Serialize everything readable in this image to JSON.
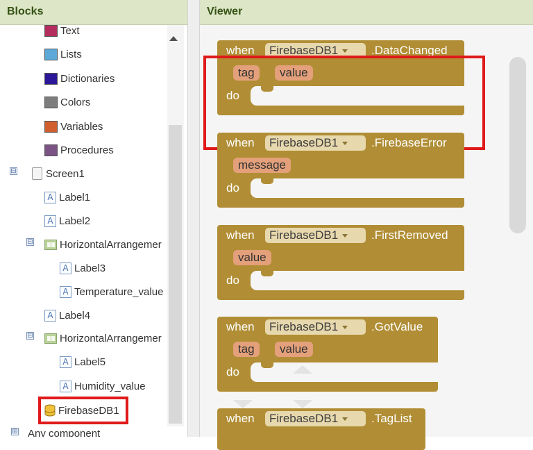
{
  "blocks_panel": {
    "title": "Blocks",
    "items": [
      {
        "label": "Text",
        "color": "#b32d5e"
      },
      {
        "label": "Lists",
        "color": "#5ba8d9"
      },
      {
        "label": "Dictionaries",
        "color": "#2d1799"
      },
      {
        "label": "Colors",
        "color": "#7d7d7d"
      },
      {
        "label": "Variables",
        "color": "#d05f2d"
      },
      {
        "label": "Procedures",
        "color": "#7c5385"
      }
    ],
    "screen": "Screen1",
    "components": [
      "Label1",
      "Label2",
      "HorizontalArrangemer",
      "Label3",
      "Temperature_value",
      "Label4",
      "HorizontalArrangemer",
      "Label5",
      "Humidity_value",
      "FirebaseDB1",
      "Any component"
    ],
    "toggle_minus": "⊟",
    "toggle_plus": "⊞",
    "label_icon_glyph": "A"
  },
  "viewer": {
    "title": "Viewer",
    "when_label": "when",
    "do_label": "do",
    "component": "FirebaseDB1",
    "events": [
      {
        "name": ".DataChanged",
        "params": [
          "tag",
          "value"
        ]
      },
      {
        "name": ".FirebaseError",
        "params": [
          "message"
        ]
      },
      {
        "name": ".FirstRemoved",
        "params": [
          "value"
        ]
      },
      {
        "name": ".GotValue",
        "params": [
          "tag",
          "value"
        ]
      },
      {
        "name": ".TagList",
        "params": []
      }
    ]
  },
  "colors": {
    "event_block": "#b18e35",
    "component_dropdown": "#e7d8ad",
    "param": "#e3a07b",
    "highlight": "#e01a1a",
    "header_bg": "#dde6c6"
  }
}
